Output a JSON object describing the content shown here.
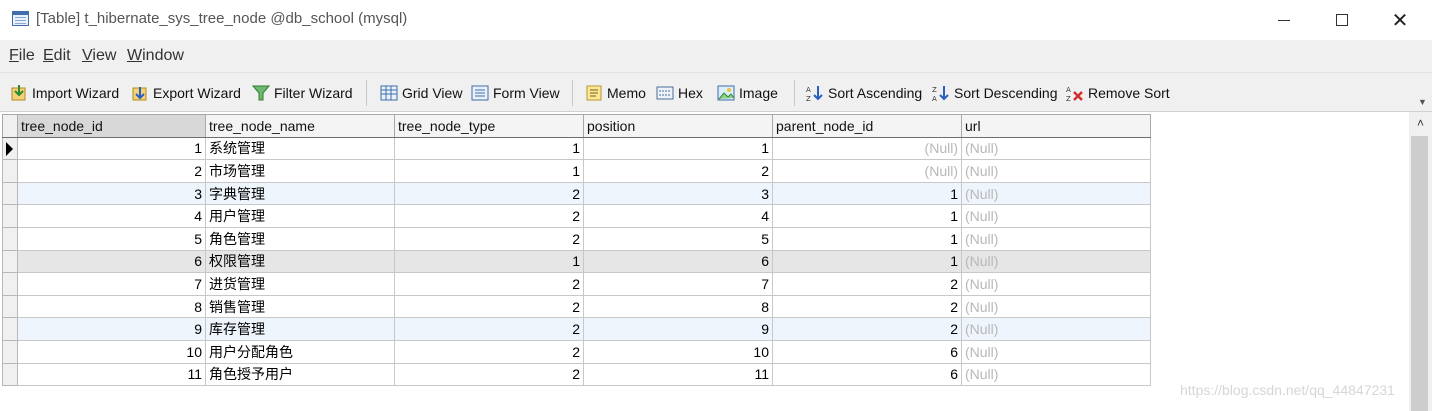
{
  "window": {
    "title": "[Table] t_hibernate_sys_tree_node @db_school (mysql)",
    "minimize_icon": "minimize-icon",
    "maximize_icon": "maximize-icon",
    "close_symbol": "✕"
  },
  "menu": {
    "file": {
      "accel": "F",
      "rest": "ile"
    },
    "edit": {
      "accel": "E",
      "rest": "dit"
    },
    "view": {
      "accel": "V",
      "rest": "iew"
    },
    "window": {
      "accel": "W",
      "rest": "indow"
    }
  },
  "toolbar": {
    "import_wizard": "Import Wizard",
    "export_wizard": "Export Wizard",
    "filter_wizard": "Filter Wizard",
    "grid_view": "Grid View",
    "form_view": "Form View",
    "memo": "Memo",
    "hex": "Hex",
    "image": "Image",
    "sort_ascending": "Sort Ascending",
    "sort_descending": "Sort Descending",
    "remove_sort": "Remove Sort",
    "more_symbol": "▼"
  },
  "grid": {
    "columns": [
      "tree_node_id",
      "tree_node_name",
      "tree_node_type",
      "position",
      "parent_node_id",
      "url"
    ],
    "null_text": "(Null)",
    "rows": [
      {
        "id": "1",
        "name": "系统管理",
        "type": "1",
        "position": "1",
        "parent": "(Null)",
        "url": "(Null)"
      },
      {
        "id": "2",
        "name": "市场管理",
        "type": "1",
        "position": "2",
        "parent": "(Null)",
        "url": "(Null)"
      },
      {
        "id": "3",
        "name": "字典管理",
        "type": "2",
        "position": "3",
        "parent": "1",
        "url": "(Null)"
      },
      {
        "id": "4",
        "name": "用户管理",
        "type": "2",
        "position": "4",
        "parent": "1",
        "url": "(Null)"
      },
      {
        "id": "5",
        "name": "角色管理",
        "type": "2",
        "position": "5",
        "parent": "1",
        "url": "(Null)"
      },
      {
        "id": "6",
        "name": "权限管理",
        "type": "1",
        "position": "6",
        "parent": "1",
        "url": "(Null)"
      },
      {
        "id": "7",
        "name": "进货管理",
        "type": "2",
        "position": "7",
        "parent": "2",
        "url": "(Null)"
      },
      {
        "id": "8",
        "name": "销售管理",
        "type": "2",
        "position": "8",
        "parent": "2",
        "url": "(Null)"
      },
      {
        "id": "9",
        "name": "库存管理",
        "type": "2",
        "position": "9",
        "parent": "2",
        "url": "(Null)"
      },
      {
        "id": "10",
        "name": "用户分配角色",
        "type": "2",
        "position": "10",
        "parent": "6",
        "url": "(Null)"
      },
      {
        "id": "11",
        "name": "角色授予用户",
        "type": "2",
        "position": "11",
        "parent": "6",
        "url": "(Null)"
      }
    ]
  },
  "scrollbar": {
    "up_symbol": "˄"
  },
  "watermark": "https://blog.csdn.net/qq_44847231",
  "colors": {
    "null_text": "#b8b8b8",
    "alt_row": "#eef5fc",
    "selected_row": "#e6e6e6",
    "toolbar_bg": "#f0f0f0"
  }
}
